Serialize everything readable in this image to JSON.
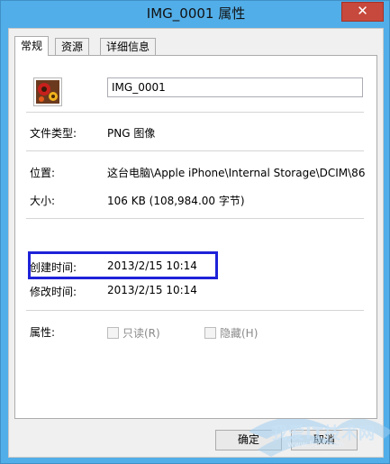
{
  "window": {
    "title": "IMG_0001 属性",
    "close_label": "✕"
  },
  "tabs": [
    {
      "label": "常规",
      "active": true
    },
    {
      "label": "资源",
      "active": false
    },
    {
      "label": "详细信息",
      "active": false
    }
  ],
  "general": {
    "file_name": "IMG_0001",
    "file_type_label": "文件类型:",
    "file_type_value": "PNG 图像",
    "location_label": "位置:",
    "location_value": "这台电脑\\Apple iPhone\\Internal Storage\\DCIM\\86",
    "size_label": "大小:",
    "size_value": "106 KB (108,984.00 字节)",
    "created_label": "创建时间:",
    "created_value": "2013/2/15 10:14",
    "modified_label": "修改时间:",
    "modified_value": "2013/2/15 10:14",
    "attributes_label": "属性:",
    "readonly_label": "只读(R)",
    "hidden_label": "隐藏(H)"
  },
  "buttons": {
    "ok_label": "确定",
    "cancel_label": "取消"
  },
  "watermark": {
    "text": "我爱IT技术网",
    "url": "www.52ij.com"
  },
  "colors": {
    "title_bar": "#52aee8",
    "close_button": "#c7483c",
    "highlight_box": "#1e22d8"
  }
}
